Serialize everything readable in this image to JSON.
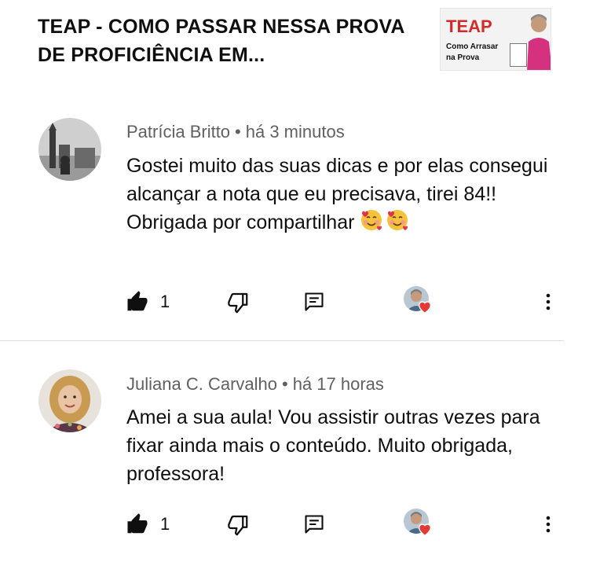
{
  "video": {
    "title": "TEAP - COMO PASSAR NESSA PROVA DE PROFICIÊNCIA EM...",
    "thumbnail": {
      "brand": "TEAP",
      "subtitle": "Como Arrasar na Prova"
    }
  },
  "comments": [
    {
      "author": "Patrícia Britto",
      "separator": "•",
      "time": "há 3 minutos",
      "text": "Gostei muito das suas dicas e por elas consegui alcançar a nota que eu precisava, tirei 84!! Obrigada por compartilhar",
      "emojis": [
        "smiling-face-with-hearts",
        "smiling-face-with-hearts"
      ],
      "likes": "1",
      "creator_hearted": true
    },
    {
      "author": "Juliana C. Carvalho",
      "separator": "•",
      "time": "há 17 horas",
      "text": "Amei a sua aula! Vou assistir outras vezes para fixar ainda mais o conteúdo. Muito obrigada, professora!",
      "likes": "1",
      "creator_hearted": true
    }
  ],
  "colors": {
    "text_primary": "#0f0f0f",
    "text_secondary": "#606060",
    "heart": "#e53935",
    "thumb_brand": "#d42a2a"
  },
  "icons": [
    "thumb-up-icon",
    "thumb-down-icon",
    "reply-icon",
    "creator-heart-icon",
    "more-vert-icon"
  ]
}
